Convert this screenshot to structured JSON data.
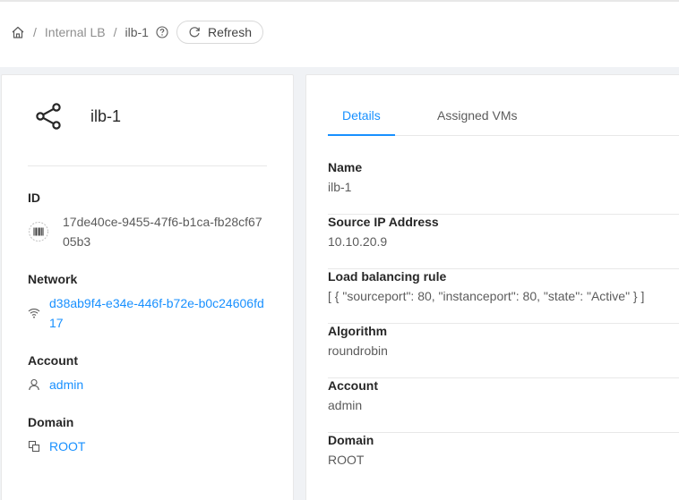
{
  "breadcrumb": {
    "items": [
      "Internal LB",
      "ilb-1"
    ],
    "separator": "/"
  },
  "toolbar": {
    "refresh_label": "Refresh"
  },
  "resource": {
    "name": "ilb-1",
    "icon": "share-icon"
  },
  "left_panel": {
    "id_label": "ID",
    "id_value": "17de40ce-9455-47f6-b1ca-fb28cf6705b3",
    "network_label": "Network",
    "network_value": "d38ab9f4-e34e-446f-b72e-b0c24606fd17",
    "account_label": "Account",
    "account_value": "admin",
    "domain_label": "Domain",
    "domain_value": "ROOT"
  },
  "tabs": [
    {
      "label": "Details",
      "active": true
    },
    {
      "label": "Assigned VMs",
      "active": false
    }
  ],
  "details": [
    {
      "label": "Name",
      "value": "ilb-1"
    },
    {
      "label": "Source IP Address",
      "value": "10.10.20.9"
    },
    {
      "label": "Load balancing rule",
      "value": "[ { \"sourceport\": 80, \"instanceport\": 80, \"state\": \"Active\" } ]"
    },
    {
      "label": "Algorithm",
      "value": "roundrobin"
    },
    {
      "label": "Account",
      "value": "admin"
    },
    {
      "label": "Domain",
      "value": "ROOT"
    }
  ],
  "colors": {
    "accent": "#1890ff",
    "background": "#f0f2f5",
    "border": "#e8e8e8"
  }
}
